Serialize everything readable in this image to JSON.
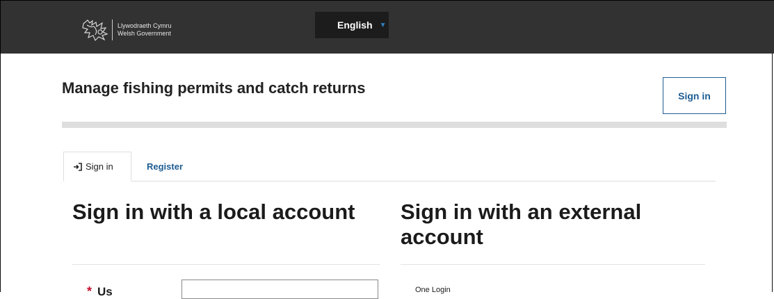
{
  "header": {
    "logo_text_line1": "Llywodraeth Cymru",
    "logo_text_line2": "Welsh Government",
    "language": "English"
  },
  "page": {
    "title": "Manage fishing permits and catch returns",
    "signin_button": "Sign in"
  },
  "tabs": [
    {
      "label": "Sign in",
      "active": true
    },
    {
      "label": "Register",
      "active": false
    }
  ],
  "local": {
    "heading": "Sign in with a local account",
    "required_marker": "*",
    "username_label": "Us"
  },
  "external": {
    "heading": "Sign in with an external account",
    "provider": "One Login"
  },
  "colors": {
    "topbar": "#323232",
    "link_blue": "#1d5c92",
    "required_red": "#c8102e"
  }
}
